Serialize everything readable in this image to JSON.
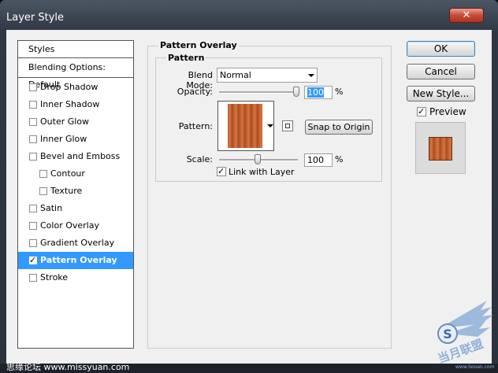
{
  "window": {
    "title": "Layer Style",
    "close_label": "✕"
  },
  "styles_list": {
    "header": "Styles",
    "blending_options": "Blending Options: Default",
    "items": [
      {
        "label": "Drop Shadow",
        "checked": false
      },
      {
        "label": "Inner Shadow",
        "checked": false
      },
      {
        "label": "Outer Glow",
        "checked": false
      },
      {
        "label": "Inner Glow",
        "checked": false
      },
      {
        "label": "Bevel and Emboss",
        "checked": false
      },
      {
        "label": "Contour",
        "checked": false
      },
      {
        "label": "Texture",
        "checked": false
      },
      {
        "label": "Satin",
        "checked": false
      },
      {
        "label": "Color Overlay",
        "checked": false
      },
      {
        "label": "Gradient Overlay",
        "checked": false
      },
      {
        "label": "Pattern Overlay",
        "checked": true,
        "selected": true
      },
      {
        "label": "Stroke",
        "checked": false
      }
    ]
  },
  "panel": {
    "title": "Pattern Overlay",
    "group_title": "Pattern",
    "blend_mode_label": "Blend Mode:",
    "blend_mode_value": "Normal",
    "opacity_label": "Opacity:",
    "opacity_value": "100",
    "opacity_unit": "%",
    "pattern_label": "Pattern:",
    "snap_button": "Snap to Origin",
    "scale_label": "Scale:",
    "scale_value": "100",
    "scale_unit": "%",
    "link_label": "Link with Layer",
    "link_checked": true
  },
  "buttons": {
    "ok": "OK",
    "cancel": "Cancel",
    "new_style": "New Style..."
  },
  "preview": {
    "label": "Preview",
    "checked": true
  },
  "watermark": {
    "left_text": "思缘论坛  www.missyuan.com",
    "logo_text": "当月联盟",
    "logo_url": "www.Sooan.com"
  },
  "colors": {
    "selection": "#3399ff",
    "wood_light": "#d9773f",
    "wood_dark": "#a44a22"
  }
}
